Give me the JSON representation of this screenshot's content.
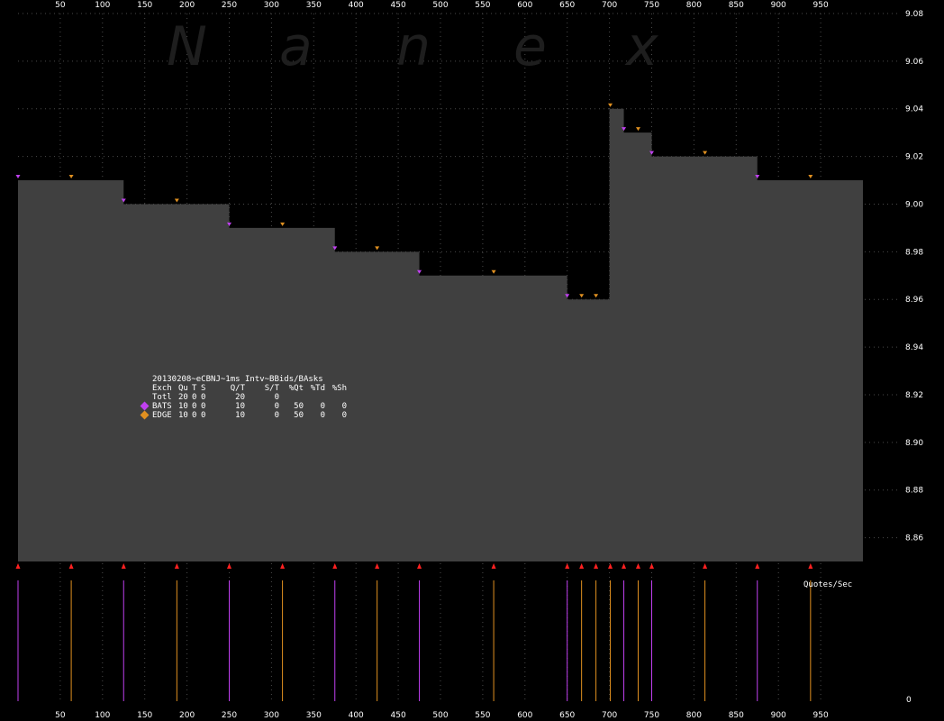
{
  "watermark": [
    "N",
    "a",
    "n",
    "e",
    "x"
  ],
  "chart_data": {
    "type": "area",
    "x_ticks": [
      50,
      100,
      150,
      200,
      250,
      300,
      350,
      400,
      450,
      500,
      550,
      600,
      650,
      700,
      750,
      800,
      850,
      900,
      950
    ],
    "y_ticks": [
      "9.08",
      "9.06",
      "9.04",
      "9.02",
      "9.00",
      "8.98",
      "8.96",
      "8.94",
      "8.92",
      "8.90",
      "8.88",
      "8.86"
    ],
    "ylim": [
      8.85,
      9.08
    ],
    "xlim": [
      0,
      1000
    ],
    "series": [
      {
        "type": "step",
        "x": [
          0,
          125,
          250,
          375,
          475,
          650,
          700,
          717,
          750,
          875,
          938
        ],
        "y": [
          9.01,
          9.0,
          8.99,
          8.98,
          8.97,
          8.96,
          9.04,
          9.03,
          9.02,
          9.01,
          9.01
        ]
      }
    ],
    "quote_markers": [
      {
        "x": 0,
        "y": 9.01,
        "exch": "BATS"
      },
      {
        "x": 63,
        "y": 9.01,
        "exch": "EDGE"
      },
      {
        "x": 125,
        "y": 9.0,
        "exch": "BATS"
      },
      {
        "x": 188,
        "y": 9.0,
        "exch": "EDGE"
      },
      {
        "x": 250,
        "y": 8.99,
        "exch": "BATS"
      },
      {
        "x": 313,
        "y": 8.99,
        "exch": "EDGE"
      },
      {
        "x": 375,
        "y": 8.98,
        "exch": "BATS"
      },
      {
        "x": 425,
        "y": 8.98,
        "exch": "EDGE"
      },
      {
        "x": 475,
        "y": 8.97,
        "exch": "BATS"
      },
      {
        "x": 563,
        "y": 8.97,
        "exch": "EDGE"
      },
      {
        "x": 650,
        "y": 8.96,
        "exch": "BATS"
      },
      {
        "x": 667,
        "y": 8.96,
        "exch": "EDGE"
      },
      {
        "x": 684,
        "y": 8.96,
        "exch": "EDGE"
      },
      {
        "x": 701,
        "y": 9.04,
        "exch": "EDGE"
      },
      {
        "x": 717,
        "y": 9.03,
        "exch": "BATS"
      },
      {
        "x": 734,
        "y": 9.03,
        "exch": "EDGE"
      },
      {
        "x": 750,
        "y": 9.02,
        "exch": "BATS"
      },
      {
        "x": 813,
        "y": 9.02,
        "exch": "EDGE"
      },
      {
        "x": 875,
        "y": 9.01,
        "exch": "BATS"
      },
      {
        "x": 938,
        "y": 9.01,
        "exch": "EDGE"
      }
    ],
    "rate_axis": {
      "label": "Quotes/Sec",
      "zero_label": "0"
    },
    "colors": {
      "BATS": "#c040f0",
      "EDGE": "#e09020",
      "fill": "#404040",
      "grid": "#4a4a4a",
      "tick_arrow": "#ff2020"
    }
  },
  "stats": {
    "title": "20130208~eCBNJ~1ms Intv~BBids/BAsks",
    "header": [
      "Exch",
      "Qu",
      "T",
      "S",
      "Q/T",
      "S/T",
      "%Qt",
      "%Td",
      "%Sh"
    ],
    "rows": [
      {
        "exch": "Totl",
        "qu": "20",
        "t": "0",
        "s": "0",
        "qt": "20",
        "st": "0",
        "pq": "",
        "td": "",
        "sh": "",
        "color": ""
      },
      {
        "exch": "BATS",
        "qu": "10",
        "t": "0",
        "s": "0",
        "qt": "10",
        "st": "0",
        "pq": "50",
        "td": "0",
        "sh": "0",
        "color": "#c040f0"
      },
      {
        "exch": "EDGE",
        "qu": "10",
        "t": "0",
        "s": "0",
        "qt": "10",
        "st": "0",
        "pq": "50",
        "td": "0",
        "sh": "0",
        "color": "#e09020"
      }
    ]
  }
}
